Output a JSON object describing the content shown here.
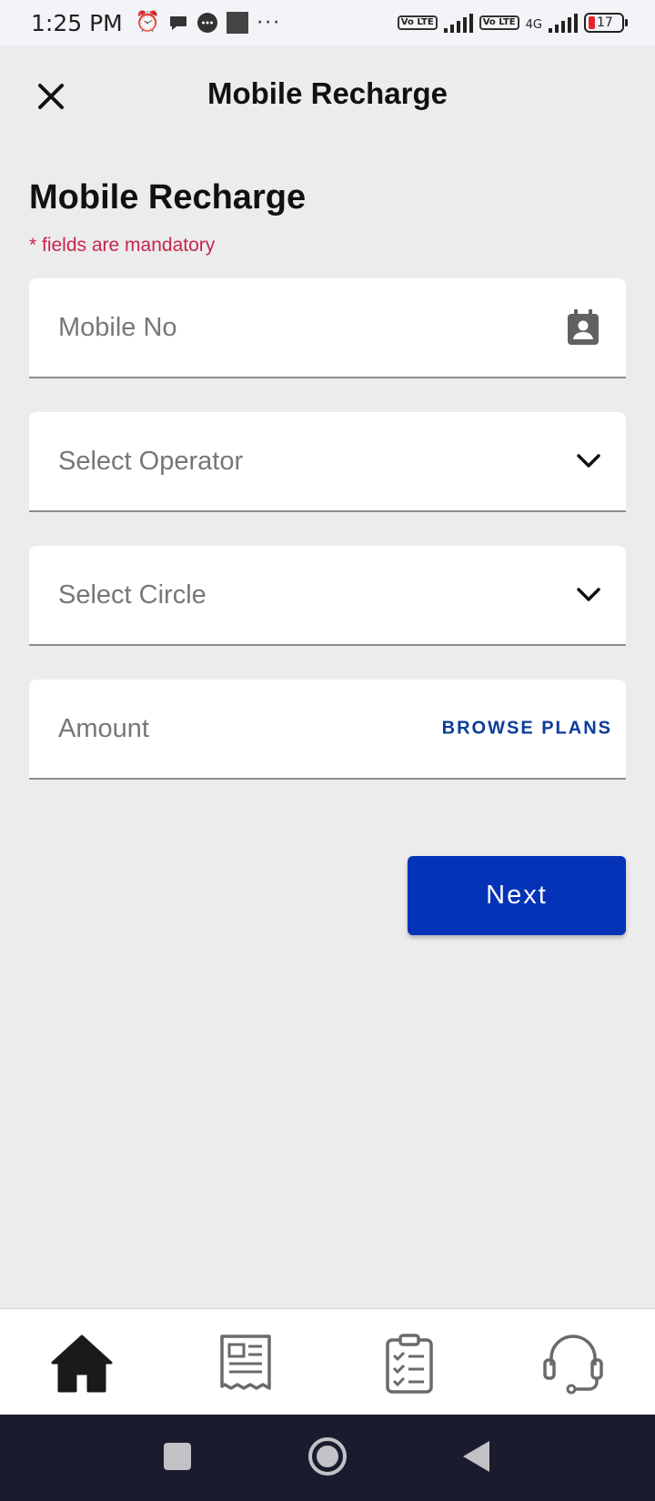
{
  "status_bar": {
    "time": "1:25 PM",
    "network_label": "4G",
    "battery_level": "17",
    "volte_label": "Vo LTE",
    "icons": [
      "alarm-icon",
      "chat-bubble-icon",
      "message-icon",
      "square-icon",
      "more-dots-icon",
      "signal-icon",
      "battery-icon"
    ]
  },
  "header": {
    "title": "Mobile Recharge"
  },
  "form": {
    "title": "Mobile Recharge",
    "mandatory_note": "* fields are mandatory",
    "mobile_placeholder": "Mobile No",
    "operator_label": "Select Operator",
    "circle_label": "Select Circle",
    "amount_placeholder": "Amount",
    "browse_plans_label": "BROWSE PLANS",
    "next_label": "Next"
  },
  "bottom_nav": {
    "items": [
      "home-icon",
      "bill-icon",
      "checklist-icon",
      "support-headset-icon"
    ],
    "active": "home-icon"
  },
  "colors": {
    "primary": "#0433b8",
    "accent_text": "#0a3c9a",
    "mandatory": "#c8264b",
    "background": "#ececed"
  }
}
